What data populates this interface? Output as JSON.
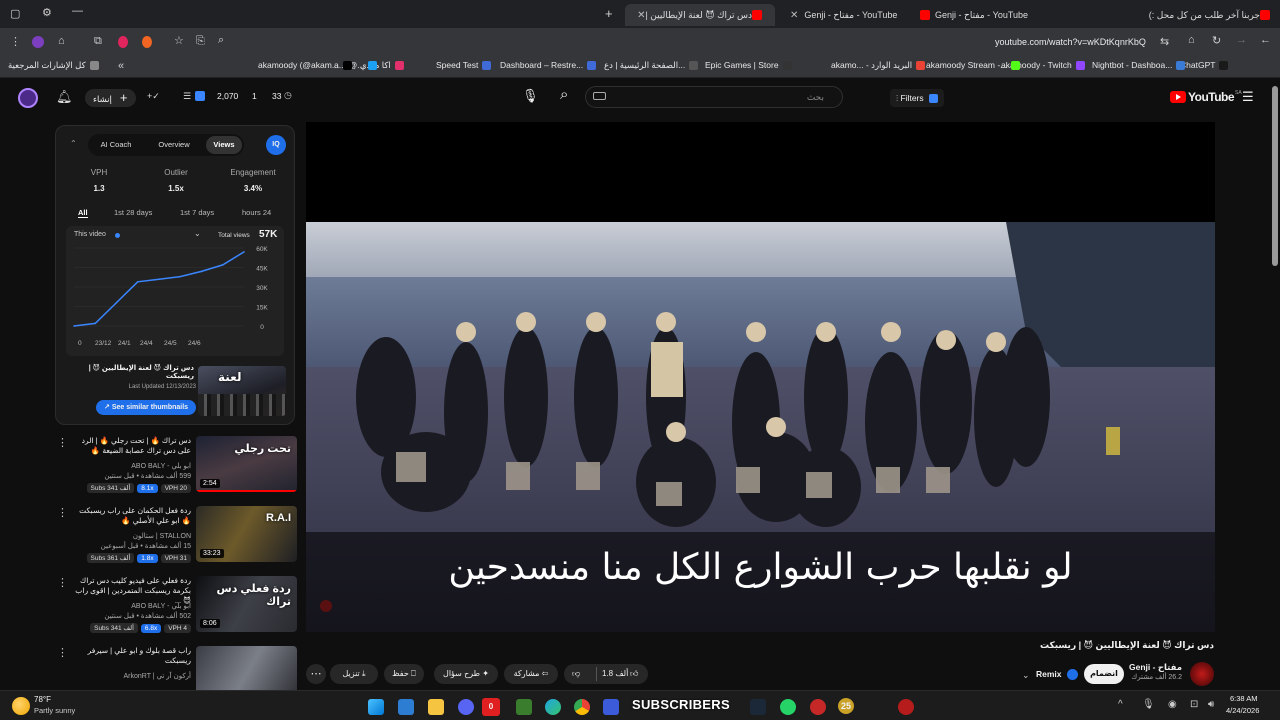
{
  "browser": {
    "tabs": [
      {
        "label": "جربنا آخر طلب من كل محل :)"
      },
      {
        "label": "Genji - مفتاح - YouTube"
      },
      {
        "label": "Genji - مفتاح - YouTube"
      },
      {
        "label": "دس تراك 😈 لعنة الإيطاليين |"
      }
    ],
    "url": "youtube.com/watch?v=wKDtKqnrKbQ",
    "bookmarks": [
      {
        "label": "ChatGPT",
        "color": "#1a1a1a"
      },
      {
        "label": "Nightbot - Dashboa...",
        "color": "#3a7bd5"
      },
      {
        "label": "akamoody - Twitch",
        "color": "#9146ff"
      },
      {
        "label": "akamoody Stream -...",
        "color": "#53fc18"
      },
      {
        "label": "akamo... - البريد الوارد",
        "color": "#ea4335"
      },
      {
        "label": "Epic Games | Store",
        "color": "#333"
      },
      {
        "label": "الصفحة الرئيسية | دع...",
        "color": "#555"
      },
      {
        "label": "Dashboard – Restre...",
        "color": "#3f6ad8"
      },
      {
        "label": "Speed Test",
        "color": "#3f6ad8"
      },
      {
        "label": "اكا مودي",
        "color": "#e1306c"
      },
      {
        "label": "a...(@...",
        "color": "#1da1f2"
      },
      {
        "label": "akamoody (@akam...",
        "color": "#000"
      },
      {
        "label": "كل الإشارات المرجعية",
        "color": "#888"
      }
    ]
  },
  "ythead": {
    "logo": "YouTube",
    "country": "SA",
    "search_placeholder": "بحث",
    "filters": "Filters",
    "create": "إنشاء",
    "stats": "2,070",
    "count1": "1",
    "count2": "33"
  },
  "vidiq": {
    "tabs": [
      "Views",
      "Overview",
      "AI Coach"
    ],
    "stats": [
      {
        "label": "VPH",
        "value": "1.3"
      },
      {
        "label": "Outlier",
        "value": "1.5x"
      },
      {
        "label": "Engagement",
        "value": "3.4%"
      }
    ],
    "filters": [
      "All",
      "1st 28 days",
      "1st 7 days",
      "hours 24"
    ],
    "this_video": "This video",
    "total_views_label": "Total views",
    "total_views": "57K",
    "thumb_title": "دس تراك 😈 لعنة الإيطاليين 😈 | ريسبكت",
    "last_updated": "Last Updated 12/13/2023",
    "similar_btn": "See similar thumbnails"
  },
  "chart_data": {
    "type": "line",
    "x": [
      "0",
      "23/12",
      "24/1",
      "24/4",
      "24/5",
      "24/6"
    ],
    "y_ticks": [
      "60K",
      "45K",
      "30K",
      "15K",
      "0"
    ],
    "ylim": [
      0,
      60000
    ],
    "series": [
      {
        "values": [
          0,
          2000,
          18000,
          34000,
          36000,
          38000,
          42000,
          47000,
          57000
        ]
      }
    ],
    "grid": true
  },
  "recommendations": [
    {
      "title": "دس تراك 🔥 | تحت رجلي 🔥 | الرد على دس تراك عصابة الضيعة 🔥",
      "channel": "ABO BALY - ابو بلي",
      "views": "599 ألف مشاهدة • قبل سنتين",
      "duration": "2:54",
      "subs": "Subs 341 ألف",
      "outlier": "8.1x",
      "vph": "VPH 20",
      "thumb_text": "تحت رجلي"
    },
    {
      "title": "ردة فعل الحكمان على راب ريسبكت 🔥 ابو علي الأصلي 🔥",
      "channel": "ستالون | STALLON",
      "views": "15 ألف مشاهدة • قبل أسبوعين",
      "duration": "33:23",
      "subs": "Subs 361 ألف",
      "outlier": "1.8x",
      "vph": "VPH 31",
      "thumb_text": "R.A.I"
    },
    {
      "title": "ردة فعلي على فيديو كليب دس تراك بكرمة ريسبكت المتمردين | اقوى راب 😈 ...",
      "channel": "ABO BALY - ابو بلي",
      "views": "502 ألف مشاهدة • قبل سنتين",
      "duration": "8:06",
      "subs": "Subs 341 ألف",
      "outlier": "6.8x",
      "vph": "VPH 4",
      "thumb_text": "ردة فعلي دس تراك"
    },
    {
      "title": "راب قصة بلوك و ابو علي | سيرفر ريسبكت",
      "channel": "ArkonRT | أركون آر تي",
      "views": "",
      "duration": "",
      "subs": "",
      "outlier": "",
      "vph": "",
      "thumb_text": ""
    }
  ],
  "player": {
    "subtitle": "لو نقلبها حرب الشوارع الكل منا منسدحين"
  },
  "video": {
    "title": "دس تراك 😈 لعنة الإيطاليين 😈 | ريسبكت",
    "channel": "Genji - مفتاح",
    "subs": "26.2 ألف مشترك",
    "join": "انضمام",
    "remix": "Remix",
    "likes": "1.8 ألف",
    "share": "مشاركة",
    "ask": "طرح سؤال",
    "save": "حفظ",
    "download": "تنزيل"
  },
  "taskbar": {
    "temp": "78°F",
    "weather": "Partly sunny",
    "subscribers_label": "SUBSCRIBERS",
    "badge": "25",
    "time": "6:38 AM",
    "date": "4/24/2026"
  }
}
